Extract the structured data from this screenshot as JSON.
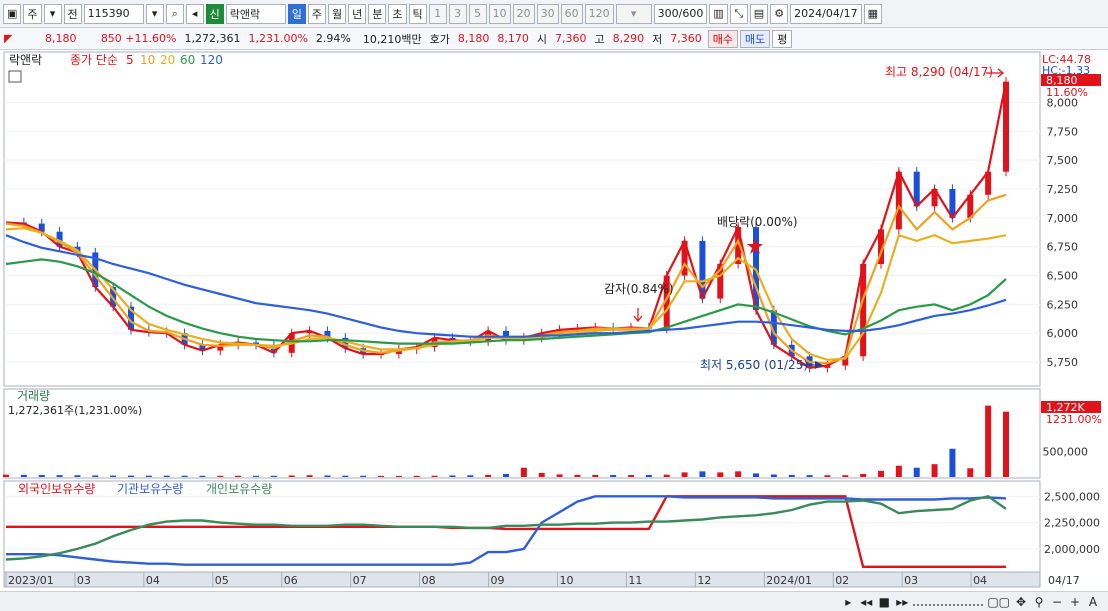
{
  "toolbar": {
    "period": "주",
    "prefix": "전",
    "code": "115390",
    "badge": "신",
    "name": "락앤락",
    "tf": [
      "일",
      "주",
      "월",
      "년",
      "분",
      "초",
      "틱"
    ],
    "active_tf": "일",
    "nums": [
      "1",
      "3",
      "5",
      "10",
      "20",
      "30",
      "60",
      "120"
    ],
    "count": "300/600",
    "date": "2024/04/17"
  },
  "info": {
    "price": "8,180",
    "change": "850 +11.60%",
    "volume": "1,272,361",
    "vol_pct": "1,231.00%",
    "turnover_pct": "2.94%",
    "amount": "10,210백만",
    "quote_label": "호가",
    "ask": "8,180",
    "bid": "8,170",
    "open_label": "시",
    "open": "7,360",
    "high_label": "고",
    "high": "8,290",
    "low_label": "저",
    "low": "7,360",
    "buy": "매수",
    "sell": "매도",
    "eval": "평"
  },
  "colors": {
    "up": "#e0131b",
    "down": "#1b4fd8",
    "ma5": "#e0131b",
    "ma10": "#f0a020",
    "ma20": "#e8b020",
    "ma60": "#2a9a4a",
    "ma120": "#2f5fd8",
    "foreign": "#e0131b",
    "inst": "#2f5fd8",
    "indiv": "#3a8a5a"
  },
  "chart_data": [
    {
      "type": "line",
      "name": "price",
      "title": "락앤락",
      "legend": [
        "종가 단순",
        "5",
        "10",
        "20",
        "60",
        "120"
      ],
      "x_ticks": [
        "2023/01",
        "03",
        "04",
        "05",
        "06",
        "07",
        "08",
        "09",
        "10",
        "11",
        "12",
        "2024/01",
        "02",
        "03",
        "04",
        "04/17"
      ],
      "y_ticks": [
        5750,
        6000,
        6250,
        6500,
        6750,
        7000,
        7250,
        7500,
        7750,
        8000
      ],
      "ylim": [
        5560,
        8420
      ],
      "series": [
        {
          "name": "5",
          "values": [
            6960,
            6950,
            6880,
            6750,
            6700,
            6400,
            6230,
            6030,
            6010,
            6000,
            5900,
            5850,
            5900,
            5920,
            5900,
            5830,
            6000,
            6020,
            5960,
            5870,
            5820,
            5820,
            5860,
            5880,
            5960,
            5940,
            5930,
            6020,
            5940,
            5960,
            6000,
            6030,
            6040,
            6050,
            6040,
            6050,
            6040,
            6500,
            6800,
            6300,
            6600,
            6920,
            6200,
            5900,
            5800,
            5700,
            5720,
            5800,
            6600,
            6900,
            7400,
            7100,
            7250,
            7000,
            7200,
            7400,
            8180
          ]
        },
        {
          "name": "10",
          "values": [
            6950,
            6930,
            6870,
            6790,
            6700,
            6500,
            6300,
            6100,
            6020,
            6010,
            5950,
            5900,
            5890,
            5900,
            5900,
            5870,
            5930,
            5980,
            5970,
            5900,
            5850,
            5830,
            5850,
            5870,
            5920,
            5930,
            5940,
            5980,
            5960,
            5950,
            5980,
            6010,
            6020,
            6040,
            6040,
            6040,
            6040,
            6300,
            6600,
            6400,
            6550,
            6800,
            6400,
            6000,
            5850,
            5750,
            5740,
            5790,
            6300,
            6700,
            7100,
            6900,
            7050,
            6900,
            7000,
            7150,
            7200
          ]
        },
        {
          "name": "20",
          "values": [
            6900,
            6910,
            6870,
            6800,
            6720,
            6550,
            6380,
            6200,
            6080,
            6030,
            5990,
            5950,
            5920,
            5910,
            5900,
            5890,
            5910,
            5950,
            5960,
            5930,
            5890,
            5860,
            5860,
            5870,
            5900,
            5920,
            5930,
            5960,
            5960,
            5950,
            5970,
            5990,
            6000,
            6020,
            6030,
            6030,
            6040,
            6200,
            6450,
            6450,
            6500,
            6650,
            6550,
            6200,
            5950,
            5820,
            5770,
            5780,
            6000,
            6350,
            6850,
            6800,
            6850,
            6780,
            6800,
            6820,
            6850
          ]
        },
        {
          "name": "60",
          "values": [
            6600,
            6620,
            6640,
            6620,
            6580,
            6520,
            6430,
            6330,
            6230,
            6150,
            6090,
            6040,
            6000,
            5970,
            5950,
            5940,
            5930,
            5930,
            5940,
            5940,
            5930,
            5920,
            5910,
            5910,
            5910,
            5910,
            5920,
            5930,
            5940,
            5940,
            5950,
            5960,
            5970,
            5980,
            5990,
            6000,
            6010,
            6050,
            6100,
            6150,
            6200,
            6250,
            6230,
            6180,
            6120,
            6060,
            6020,
            5990,
            6040,
            6110,
            6200,
            6230,
            6250,
            6200,
            6250,
            6330,
            6470
          ]
        },
        {
          "name": "120",
          "values": [
            6850,
            6790,
            6740,
            6710,
            6680,
            6650,
            6600,
            6560,
            6520,
            6470,
            6420,
            6380,
            6340,
            6300,
            6260,
            6240,
            6220,
            6200,
            6170,
            6130,
            6090,
            6050,
            6020,
            6000,
            5990,
            5980,
            5970,
            5970,
            5970,
            5970,
            5980,
            5980,
            5990,
            6000,
            6000,
            6010,
            6020,
            6030,
            6040,
            6060,
            6080,
            6100,
            6100,
            6090,
            6070,
            6050,
            6030,
            6020,
            6020,
            6040,
            6070,
            6110,
            6150,
            6170,
            6200,
            6240,
            6290
          ]
        }
      ],
      "annotations": [
        {
          "text": "최고 8,290 (04/17)",
          "kind": "high"
        },
        {
          "text": "최저 5,650 (01/25)",
          "kind": "low"
        },
        {
          "text": "감자(0.84%)",
          "kind": "event"
        },
        {
          "text": "배당락(0.00%)",
          "kind": "event"
        }
      ],
      "right_labels": [
        "LC:44.78",
        "HC:-1.33",
        "8,180",
        "11.60%"
      ]
    },
    {
      "type": "bar",
      "name": "volume",
      "title": "거래량",
      "subtitle": "1,272,361주(1,231.00%)",
      "y_ticks": [
        500000
      ],
      "ylim": [
        0,
        1500000
      ],
      "values": [
        45000,
        42000,
        38000,
        36000,
        34000,
        30000,
        28000,
        27000,
        26000,
        26000,
        25000,
        24000,
        24000,
        24000,
        23000,
        24000,
        30000,
        35000,
        30000,
        26000,
        24000,
        22000,
        22000,
        23000,
        25000,
        30000,
        34000,
        42000,
        60000,
        180000,
        80000,
        50000,
        42000,
        40000,
        38000,
        38000,
        40000,
        45000,
        90000,
        110000,
        90000,
        110000,
        70000,
        48000,
        40000,
        36000,
        34000,
        35000,
        60000,
        120000,
        220000,
        180000,
        250000,
        550000,
        170000,
        1390000,
        1272361
      ],
      "right_labels": [
        "1,272K",
        "1231.00%"
      ]
    },
    {
      "type": "line",
      "name": "holdings",
      "legend": [
        "외국인보유수량",
        "기관보유수량",
        "개인보유수량"
      ],
      "y_ticks": [
        2000000,
        2250000,
        2500000
      ],
      "ylim": [
        1800000,
        2560000
      ],
      "series": [
        {
          "name": "외국인보유수량",
          "values": [
            2210000,
            2210000,
            2210000,
            2210000,
            2210000,
            2210000,
            2210000,
            2210000,
            2210000,
            2210000,
            2210000,
            2210000,
            2210000,
            2210000,
            2210000,
            2210000,
            2210000,
            2210000,
            2210000,
            2210000,
            2210000,
            2210000,
            2210000,
            2210000,
            2210000,
            2200000,
            2200000,
            2200000,
            2190000,
            2190000,
            2190000,
            2190000,
            2190000,
            2190000,
            2190000,
            2190000,
            2190000,
            2500000,
            2500000,
            2500000,
            2500000,
            2500000,
            2500000,
            2500000,
            2500000,
            2500000,
            2500000,
            2500000,
            1830000,
            1830000,
            1830000,
            1830000,
            1830000,
            1830000,
            1830000,
            1830000,
            1830000
          ]
        },
        {
          "name": "기관보유수량",
          "values": [
            1950000,
            1950000,
            1950000,
            1940000,
            1920000,
            1900000,
            1880000,
            1870000,
            1860000,
            1860000,
            1850000,
            1850000,
            1850000,
            1850000,
            1850000,
            1850000,
            1850000,
            1850000,
            1850000,
            1850000,
            1850000,
            1850000,
            1850000,
            1850000,
            1850000,
            1850000,
            1870000,
            1970000,
            1970000,
            2000000,
            2250000,
            2350000,
            2450000,
            2500000,
            2500000,
            2500000,
            2500000,
            2500000,
            2490000,
            2490000,
            2490000,
            2490000,
            2490000,
            2480000,
            2480000,
            2480000,
            2480000,
            2480000,
            2470000,
            2470000,
            2470000,
            2470000,
            2470000,
            2480000,
            2480000,
            2490000,
            2480000
          ]
        },
        {
          "name": "개인보유수량",
          "values": [
            1900000,
            1910000,
            1930000,
            1960000,
            2000000,
            2050000,
            2120000,
            2180000,
            2230000,
            2260000,
            2270000,
            2270000,
            2250000,
            2240000,
            2230000,
            2230000,
            2220000,
            2220000,
            2220000,
            2230000,
            2230000,
            2220000,
            2210000,
            2210000,
            2210000,
            2210000,
            2200000,
            2200000,
            2220000,
            2220000,
            2230000,
            2230000,
            2240000,
            2240000,
            2250000,
            2250000,
            2260000,
            2260000,
            2270000,
            2280000,
            2300000,
            2310000,
            2320000,
            2340000,
            2370000,
            2420000,
            2450000,
            2450000,
            2460000,
            2430000,
            2340000,
            2360000,
            2370000,
            2380000,
            2460000,
            2500000,
            2380000
          ]
        }
      ]
    }
  ]
}
